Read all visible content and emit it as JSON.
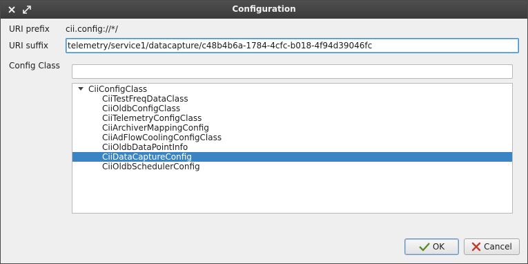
{
  "window": {
    "title": "Configuration"
  },
  "titlebar": {
    "close_icon": "close-icon",
    "maximize_icon": "maximize-icon"
  },
  "form": {
    "uri_prefix_label": "URI prefix",
    "uri_prefix_value": "cii.config://*/",
    "uri_suffix_label": "URI suffix",
    "uri_suffix_value": "telemetry/service1/datacapture/c48b4b6a-1784-4cfc-b018-4f94d39046fc",
    "config_class_label": "Config Class",
    "config_class_value": ""
  },
  "tree": {
    "root": "CiiConfigClass",
    "items": [
      "CiiTestFreqDataClass",
      "CiiOldbConfigClass",
      "CiiTelemetryConfigClass",
      "CiiArchiverMappingConfig",
      "CiiAdFlowCoolingConfigClass",
      "CiiOldbDataPointInfo",
      "CiiDataCaptureConfig",
      "CiiOldbSchedulerConfig"
    ],
    "selected": "CiiDataCaptureConfig"
  },
  "buttons": {
    "ok_label": "OK",
    "cancel_label": "Cancel"
  },
  "colors": {
    "selection": "#3a84c4",
    "titlebar": "#444444"
  }
}
